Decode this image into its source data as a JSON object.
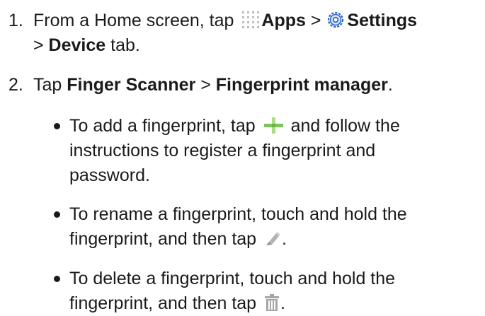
{
  "steps": [
    {
      "number": "1.",
      "lines": [
        {
          "a": "From a Home screen, tap ",
          "b": "Apps",
          "c": " > ",
          "d": "Settings"
        },
        {
          "a": "> ",
          "b": "Device",
          "c": " tab."
        }
      ]
    },
    {
      "number": "2.",
      "lines": [
        {
          "a": "Tap ",
          "b": "Finger Scanner",
          "c": " > ",
          "d": "Fingerprint manager",
          "e": "."
        }
      ]
    }
  ],
  "bullets": [
    {
      "lines": [
        {
          "a": "To add a fingerprint, tap ",
          "b": " and follow the"
        },
        {
          "a": "instructions to register a fingerprint and"
        },
        {
          "a": "password."
        }
      ]
    },
    {
      "lines": [
        {
          "a": "To rename a fingerprint, touch and hold the"
        },
        {
          "a": "fingerprint, and then tap ",
          "b": "."
        }
      ]
    },
    {
      "lines": [
        {
          "a": "To delete a fingerprint, touch and hold the"
        },
        {
          "a": "fingerprint, and then tap ",
          "b": "."
        }
      ]
    }
  ],
  "icons": {
    "apps": "apps-grid-icon",
    "settings": "settings-gear-icon",
    "add": "plus-icon",
    "rename": "pencil-icon",
    "delete": "trash-icon"
  },
  "colors": {
    "text": "#1a1a1a",
    "settings_blue": "#2a66c8",
    "icon_gray": "#a9a9a9",
    "icon_green": "#7cc35b",
    "icon_lightgreen": "#a8e07d"
  }
}
